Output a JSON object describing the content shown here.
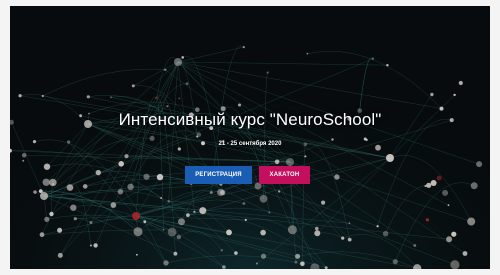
{
  "hero": {
    "title": "Интенсивный курс \"NeuroSchool\"",
    "date": "21 - 25 сентября 2020"
  },
  "buttons": {
    "register_label": "РЕГИСТРАЦИЯ",
    "hackathon_label": "ХАКАТОН"
  },
  "colors": {
    "background": "#070b0d",
    "register_button": "#1a5db5",
    "hackathon_button": "#c40f5f",
    "node_color": "#d9d2cc",
    "accent_node": "#b3252d"
  },
  "decor": {
    "background_icon": "neural-network-illustration"
  }
}
